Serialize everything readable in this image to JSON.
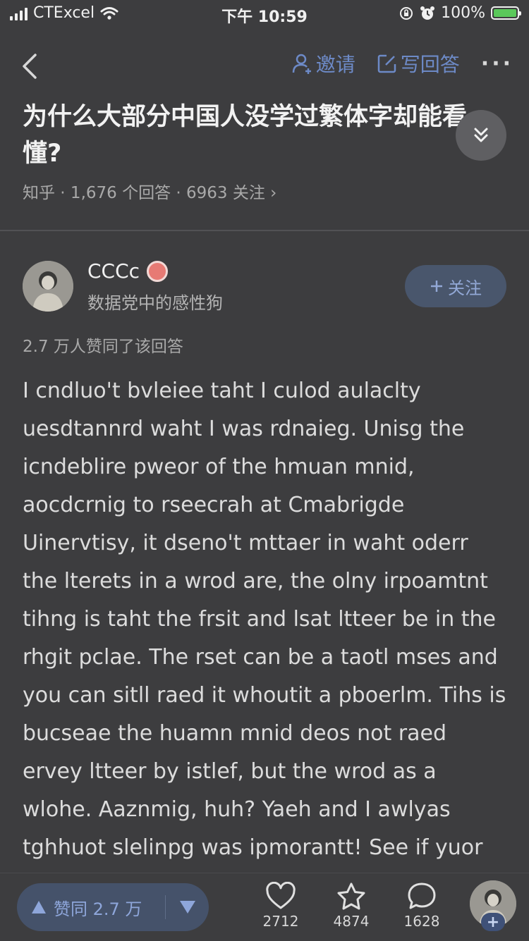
{
  "status_bar": {
    "carrier": "CTExcel",
    "time": "下午 10:59",
    "battery": "100%"
  },
  "nav": {
    "invite_label": "邀请",
    "write_answer_label": "写回答",
    "more_label": "···"
  },
  "question": {
    "title": "为什么大部分中国人没学过繁体字却能看懂?",
    "meta": "知乎 · 1,676 个回答 · 6963 关注 ›"
  },
  "author": {
    "name": "CCCc",
    "bio": "数据党中的感性狗",
    "follow_label": "关注"
  },
  "answer": {
    "upvote_summary": "2.7 万人赞同了该回答",
    "text": "I cndluo't bvleiee taht I culod aulaclty uesdtannrd waht I was rdnaieg. Unisg the icndeblire pweor of the hmuan mnid, aocdcrnig to rseecrah at Cmabrigde Uinervtisy, it dseno't mttaer in waht oderr the lterets in a wrod are, the olny irpoamtnt tihng is taht the frsit and lsat ltteer be in the rhgit pclae. The rset can be a taotl mses and you can sitll raed it whoutit a pboerlm. Tihs is bucseae the huamn mnid deos not raed ervey ltteer by istlef, but the wrod as a wlohe. Aaznmig, huh? Yaeh and I awlyas tghhuot slelinpg was ipmorantt! See if yuor"
  },
  "bottom_bar": {
    "vote_label": "赞同 2.7 万",
    "likes": "2712",
    "favorites": "4874",
    "comments": "1628",
    "plus": "+"
  },
  "colors": {
    "background": "#3d3d3f",
    "accent": "#6d8ac7",
    "vote_pill": "#45526a"
  }
}
